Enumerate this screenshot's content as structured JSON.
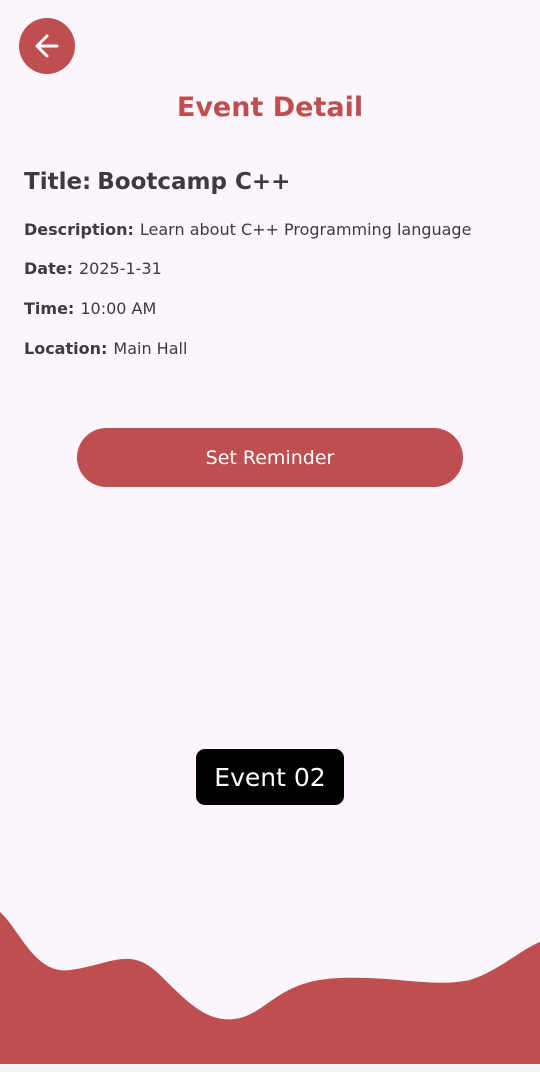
{
  "header": {
    "back_icon": "arrow-left-icon",
    "title": "Event Detail"
  },
  "event": {
    "title_label": "Title:",
    "title_value": "Bootcamp C++",
    "description_label": "Description:",
    "description_value": "Learn about C++ Programming language",
    "date_label": "Date:",
    "date_value": "2025-1-31",
    "time_label": "Time:",
    "time_value": "10:00 AM",
    "location_label": "Location:",
    "location_value": "Main Hall"
  },
  "actions": {
    "set_reminder_label": "Set Reminder"
  },
  "toast": {
    "text": "Event 02"
  },
  "colors": {
    "accent": "#bf4e51",
    "background": "#fcf5fb",
    "text": "#3f3a3d",
    "toast_bg": "#000000"
  }
}
